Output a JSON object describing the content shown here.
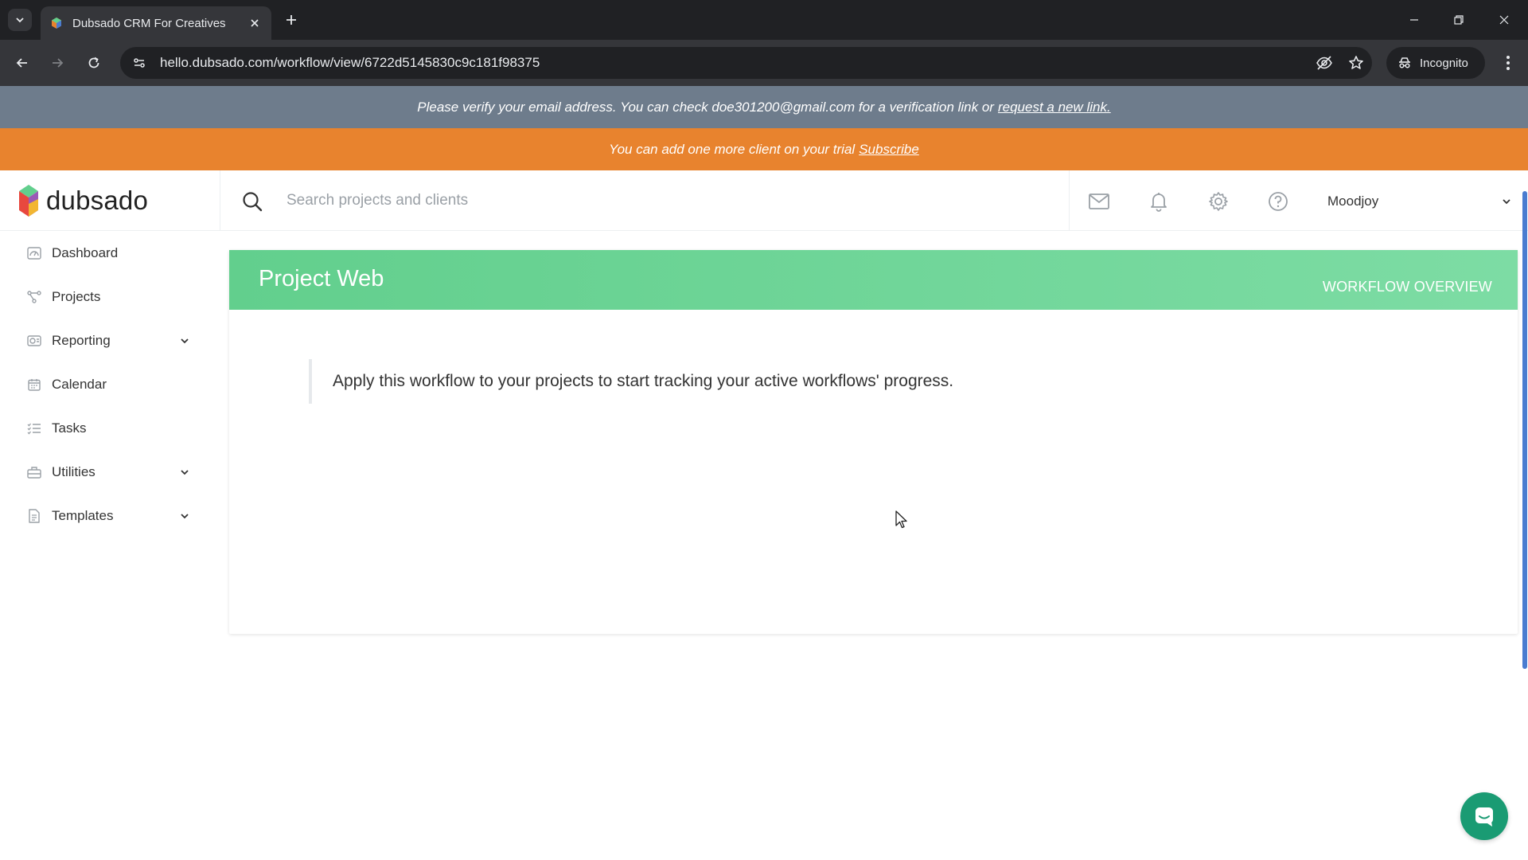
{
  "browser": {
    "tab_title": "Dubsado CRM For Creatives",
    "url": "hello.dubsado.com/workflow/view/6722d5145830c9c181f98375",
    "incognito_label": "Incognito"
  },
  "banners": {
    "verify_text": "Please verify your email address. You can check doe301200@gmail.com for a verification link or",
    "verify_link": "request a new link.",
    "trial_text": "You can add one more client on your trial",
    "trial_link": "Subscribe"
  },
  "header": {
    "brand": "dubsado",
    "search_placeholder": "Search projects and clients",
    "account_name": "Moodjoy"
  },
  "sidebar": {
    "items": [
      {
        "label": "Dashboard",
        "icon": "dashboard-icon"
      },
      {
        "label": "Projects",
        "icon": "projects-icon"
      },
      {
        "label": "Reporting",
        "icon": "reporting-icon",
        "expandable": true
      },
      {
        "label": "Calendar",
        "icon": "calendar-icon"
      },
      {
        "label": "Tasks",
        "icon": "tasks-icon"
      },
      {
        "label": "Utilities",
        "icon": "utilities-icon",
        "expandable": true
      },
      {
        "label": "Templates",
        "icon": "templates-icon",
        "expandable": true
      }
    ]
  },
  "card": {
    "title": "Project Web",
    "overview_label": "WORKFLOW OVERVIEW",
    "note": "Apply this workflow to your projects to start tracking your active workflows' progress."
  },
  "colors": {
    "verify_banner": "#6e7c8c",
    "trial_banner": "#e8832e",
    "card_header": "#62cf8d",
    "chat_button": "#1a9b73"
  }
}
